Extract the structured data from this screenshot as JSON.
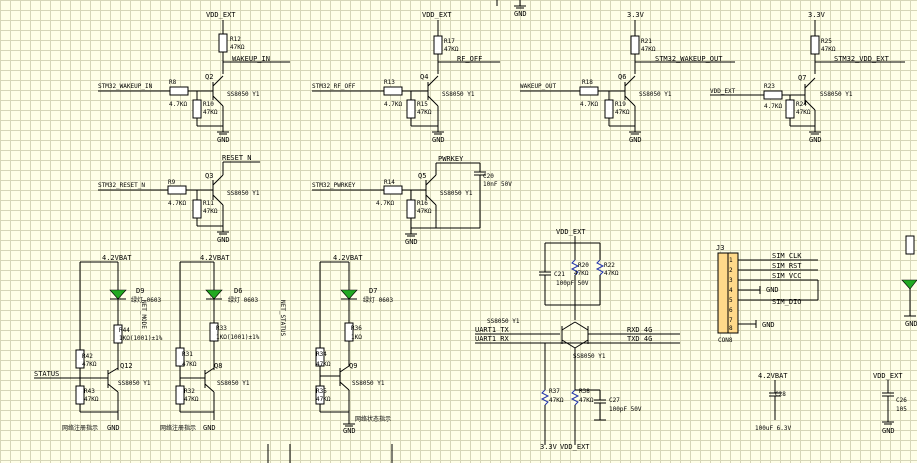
{
  "nets": {
    "vdd_ext": "VDD_EXT",
    "v33": "3.3V",
    "v42bat": "4.2VBAT",
    "gnd": "GND",
    "wakeup_in": "WAKEUP_IN",
    "stm_wakeup_in": "STM32_WAKEUP_IN",
    "reset_n": "RESET_N",
    "stm_reset_n": "STM32_RESET_N",
    "rf_off": "RF_OFF",
    "stm_rf_off": "STM32_RF_OFF",
    "pwrkey": "PWRKEY",
    "stm_pwrkey": "STM32_PWRKEY",
    "wakeup_out": "WAKEUP_OUT",
    "stm_wakeup_out": "STM32_WAKEUP_OUT",
    "stm_vdd_ext": "STM32_VDD_EXT",
    "status": "STATUS",
    "net_mode": "NET_MODE",
    "net_status": "NET_STATUS",
    "uart1_tx": "UART1_TX",
    "uart1_rx": "UART1_RX",
    "rxd_4g": "RXD_4G",
    "txd_4g": "TXD_4G",
    "sim_clk": "SIM_CLK",
    "sim_rst": "SIM_RST",
    "sim_vcc": "SIM_VCC",
    "sim_dio": "SIM_DIO"
  },
  "parts": {
    "transistor": "SS8050 Y1",
    "v47k": "47KΩ",
    "v47k_dot": "4.7KΩ",
    "v1k_1pct": "1KΩ(1001)±1%",
    "v1k": "1KΩ",
    "v10nf": "10nF 50V",
    "v100pf": "100pF 50V",
    "v100uf": "100uF 6.3V",
    "v105": "105",
    "led_desc": "绿灯 0603",
    "caption_net_reg": "网络注册指示",
    "caption_net_status": "网络状态指示",
    "conn8": "CON8",
    "r8": "R8",
    "r9": "R9",
    "r10": "R10",
    "r11": "R11",
    "r12": "R12",
    "r13": "R13",
    "r14": "R14",
    "r15": "R15",
    "r16": "R16",
    "r17": "R17",
    "r18": "R18",
    "r19": "R19",
    "r20": "R20",
    "r21": "R21",
    "r22": "R22",
    "r23": "R23",
    "r24": "R24",
    "r25": "R25",
    "r31": "R31",
    "r32": "R32",
    "r33": "R33",
    "r34": "R34",
    "r35": "R35",
    "r36": "R36",
    "r37": "R37",
    "r38": "R38",
    "r42": "R42",
    "r43": "R43",
    "r44": "R44",
    "q2": "Q2",
    "q3": "Q3",
    "q4": "Q4",
    "q5": "Q5",
    "q6": "Q6",
    "q7": "Q7",
    "q8": "Q8",
    "q9": "Q9",
    "q12": "Q12",
    "d6": "D6",
    "d7": "D7",
    "d9": "D9",
    "c20": "C20",
    "c21": "C21",
    "c26": "C26",
    "c27": "C27",
    "c28": "C28",
    "j3": "J3"
  },
  "colors": {
    "background": "#ffffe8",
    "grid": "#d6d6b8",
    "led": "#22aa22",
    "connector": "#ffd98a",
    "resistor_alt": "#2233aa"
  }
}
